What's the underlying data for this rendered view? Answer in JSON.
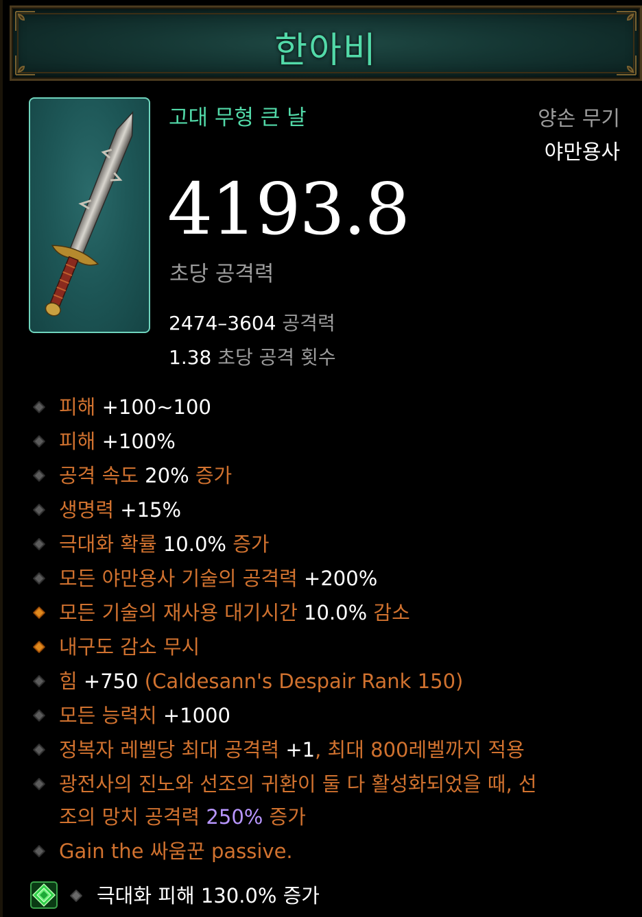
{
  "item": {
    "name": "한아비",
    "type": "고대 무형 큰 날",
    "slot": "양손 무기",
    "class": "야만용사",
    "dps": "4193.8",
    "dps_label": "초당 공격력",
    "damage_range": "2474–3604",
    "damage_label": "공격력",
    "attack_speed": "1.38",
    "attack_speed_label": "초당 공격 횟수"
  },
  "affixes": [
    {
      "kind": "primary",
      "parts": [
        [
          "o",
          "피해 "
        ],
        [
          "w",
          "+100~100"
        ]
      ]
    },
    {
      "kind": "primary",
      "parts": [
        [
          "o",
          "피해 "
        ],
        [
          "w",
          "+100%"
        ]
      ]
    },
    {
      "kind": "primary",
      "parts": [
        [
          "o",
          "공격 속도 "
        ],
        [
          "w",
          "20%"
        ],
        [
          "o",
          " 증가"
        ]
      ]
    },
    {
      "kind": "primary",
      "parts": [
        [
          "o",
          "생명력 "
        ],
        [
          "w",
          "+15%"
        ]
      ]
    },
    {
      "kind": "primary",
      "parts": [
        [
          "o",
          "극대화 확률 "
        ],
        [
          "w",
          "10.0%"
        ],
        [
          "o",
          " 증가"
        ]
      ]
    },
    {
      "kind": "primary",
      "parts": [
        [
          "o",
          "모든 야만용사 기술의 공격력 "
        ],
        [
          "w",
          "+200%"
        ]
      ]
    },
    {
      "kind": "secondary",
      "parts": [
        [
          "o",
          "모든 기술의 재사용 대기시간 "
        ],
        [
          "w",
          "10.0%"
        ],
        [
          "o",
          " 감소"
        ]
      ]
    },
    {
      "kind": "secondary",
      "parts": [
        [
          "o",
          "내구도 감소 무시"
        ]
      ]
    },
    {
      "kind": "primary",
      "parts": [
        [
          "o",
          "힘 "
        ],
        [
          "w",
          "+750"
        ],
        [
          "o",
          " (Caldesann's Despair Rank 150)"
        ]
      ]
    },
    {
      "kind": "primary",
      "parts": [
        [
          "o",
          "모든 능력치 "
        ],
        [
          "w",
          "+1000"
        ]
      ]
    },
    {
      "kind": "primary",
      "parts": [
        [
          "o",
          "정복자 레벨당 최대 공격력 "
        ],
        [
          "w",
          "+1"
        ],
        [
          "o",
          ", 최대 800레벨까지 적용"
        ]
      ]
    },
    {
      "kind": "primary",
      "parts": [
        [
          "o",
          "광전사의 진노와 선조의 귀환이 둘 다 활성화되었을 때, 선"
        ]
      ],
      "line2": [
        [
          "o",
          "조의 망치 공격력 "
        ],
        [
          "p",
          "250%"
        ],
        [
          "o",
          " 증가"
        ]
      ]
    },
    {
      "kind": "primary",
      "parts": [
        [
          "o",
          "Gain the 싸움꾼 passive."
        ]
      ]
    }
  ],
  "socket": {
    "gem": "emerald-gem-icon",
    "text": "극대화 피해 130.0% 증가"
  },
  "colors": {
    "title_green": "#52d9a8",
    "affix_orange": "#d1722f",
    "legendary_purple": "#b896ff",
    "label_gray": "#9c9c9c",
    "secondary_diamond": "#e08a1e"
  }
}
